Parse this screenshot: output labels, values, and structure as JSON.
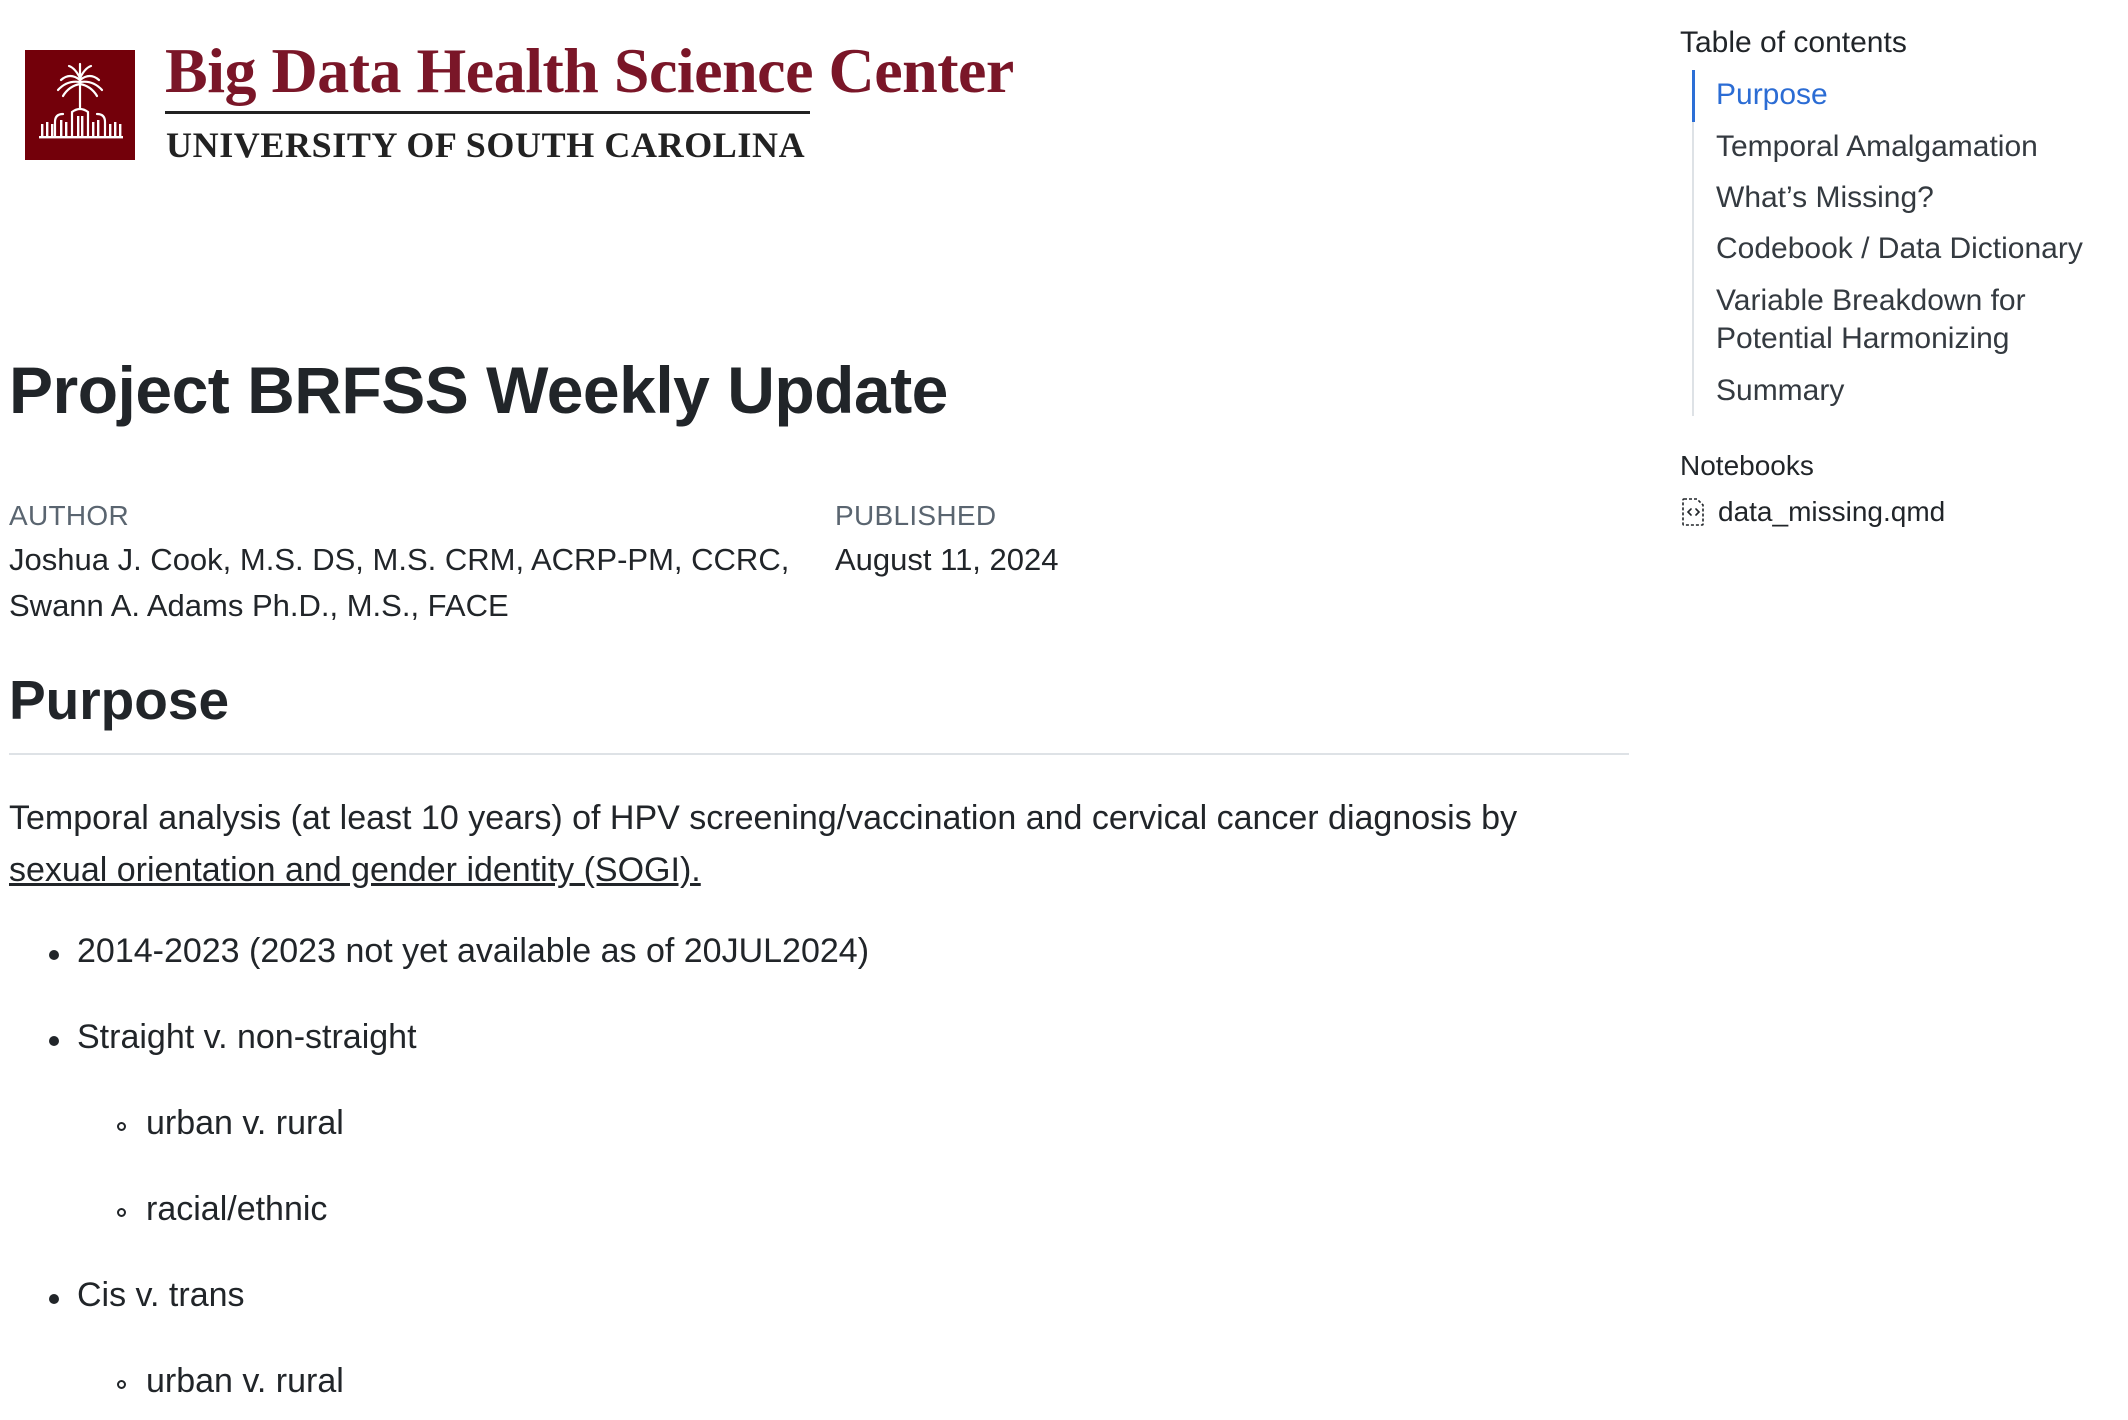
{
  "header": {
    "brand_title": "Big Data Health Science Center",
    "brand_subtitle": "UNIVERSITY OF SOUTH CAROLINA",
    "logo_icon": "palmetto-tree-icon",
    "brand_color": "#73000a"
  },
  "title": "Project BRFSS Weekly Update",
  "meta": {
    "author_label": "AUTHOR",
    "author_line1": "Joshua J. Cook, M.S. DS, M.S. CRM, ACRP-PM, CCRC,",
    "author_line2": "Swann A. Adams Ph.D., M.S., FACE",
    "published_label": "PUBLISHED",
    "published_date": "August 11, 2024"
  },
  "purpose": {
    "heading": "Purpose",
    "intro_text": "Temporal analysis (at least 10 years) of HPV screening/vaccination and cervical cancer diagnosis by",
    "intro_link": "sexual orientation and gender identity (SOGI).",
    "bullets": [
      "2014-2023 (2023 not yet available as of 20JUL2024)",
      "Straight v. non-straight",
      "urban v. rural",
      "racial/ethnic",
      "Cis v. trans",
      "urban v. rural"
    ]
  },
  "toc": {
    "title": "Table of contents",
    "items": [
      "Purpose",
      "Temporal Amalgamation",
      "What’s Missing?",
      "Codebook / Data Dictionary",
      "Variable Breakdown for",
      "Potential Harmonizing",
      "Summary"
    ],
    "active_color": "#2b6cd4"
  },
  "notebooks": {
    "title": "Notebooks",
    "items": [
      "data_missing.qmd"
    ],
    "icon": "code-file-icon"
  }
}
